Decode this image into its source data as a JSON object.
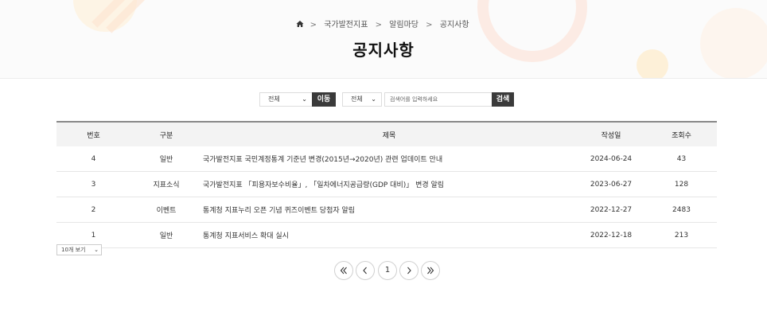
{
  "breadcrumb": {
    "items": [
      "국가발전지표",
      "알림마당",
      "공지사항"
    ]
  },
  "page_title": "공지사항",
  "search": {
    "category_selected": "전체",
    "go_label": "이동",
    "field_selected": "전체",
    "placeholder": "검색어를 입력하세요",
    "search_label": "검색"
  },
  "table": {
    "headers": [
      "번호",
      "구분",
      "제목",
      "작성일",
      "조회수"
    ],
    "rows": [
      {
        "no": "4",
        "category": "일반",
        "title": "국가발전지표 국민계정통계 기준년 변경(2015년→2020년) 관련 업데이트 안내",
        "date": "2024-06-24",
        "views": "43"
      },
      {
        "no": "3",
        "category": "지표소식",
        "title": "국가발전지표 「피용자보수비율」, 「일차에너지공급량(GDP 대비)」 변경 알림",
        "date": "2023-06-27",
        "views": "128"
      },
      {
        "no": "2",
        "category": "이벤트",
        "title": "통계청 지표누리 오픈 기념 퀴즈이벤트 당첨자 알림",
        "date": "2022-12-27",
        "views": "2483"
      },
      {
        "no": "1",
        "category": "일반",
        "title": "통계청 지표서비스 확대 실시",
        "date": "2022-12-18",
        "views": "213"
      }
    ]
  },
  "page_size": "10개 보기",
  "pagination": {
    "current": "1"
  },
  "colors": {
    "dark_button": "#3a3a3a",
    "header_row": "#f3f3f3"
  }
}
